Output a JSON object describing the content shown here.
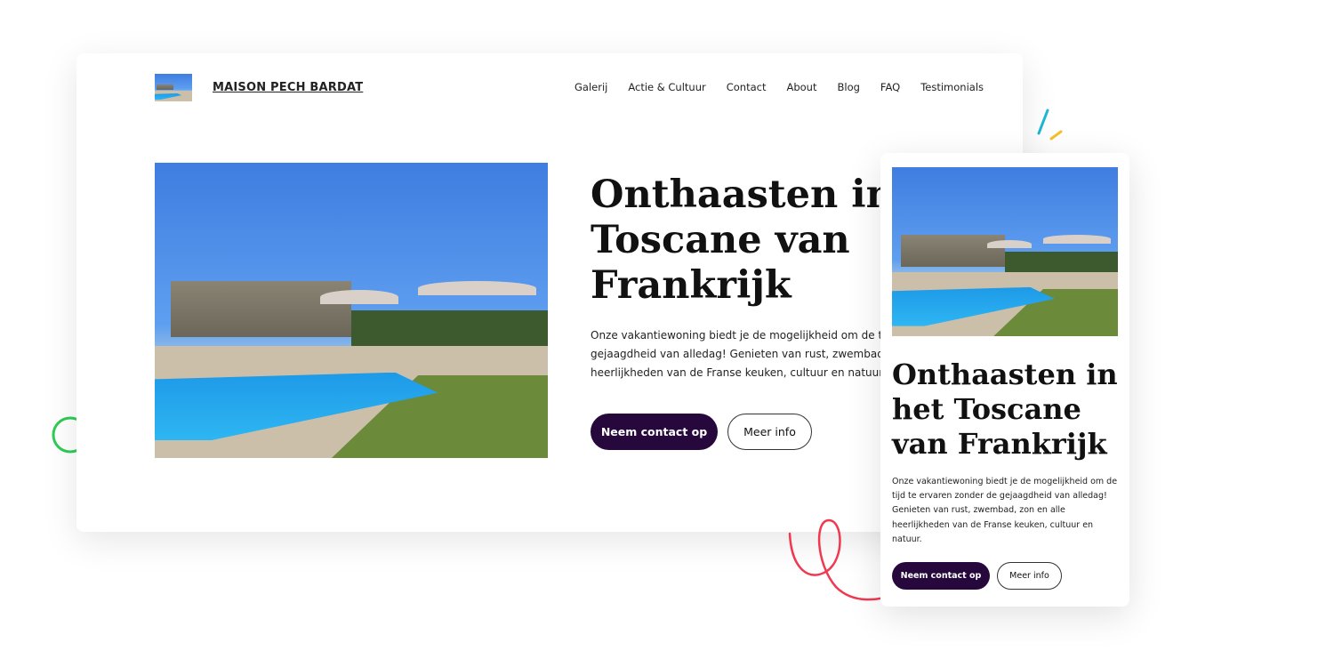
{
  "desktop": {
    "brand": "MAISON PECH BARDAT",
    "nav": [
      "Galerij",
      "Actie & Cultuur",
      "Contact",
      "About",
      "Blog",
      "FAQ",
      "Testimonials"
    ],
    "title": "Onthaasten in het Toscane van Frankrijk",
    "description": "Onze vakantiewoning biedt je de mogelijkheid om de tijd te ervaren zonder de gejaagdheid van alledag! Genieten van rust, zwembad, zon en alle heerlijkheden van de Franse keuken, cultuur en natuur.",
    "primary_button": "Neem contact op",
    "secondary_button": "Meer info"
  },
  "mobile": {
    "title": "Onthaasten in het Toscane van Frankrijk",
    "description": "Onze vakantiewoning biedt je de mogelijkheid om de tijd te ervaren zonder de gejaagdheid van alledag! Genieten van rust, zwembad, zon en alle heerlijkheden van de Franse keuken, cultuur en natuur.",
    "primary_button": "Neem contact op",
    "secondary_button": "Meer info"
  },
  "colors": {
    "primary": "#26083d",
    "decor_green": "#2ecc55",
    "decor_red": "#f0394f",
    "decor_teal": "#1fb8d6",
    "decor_yellow": "#f5c02a"
  }
}
